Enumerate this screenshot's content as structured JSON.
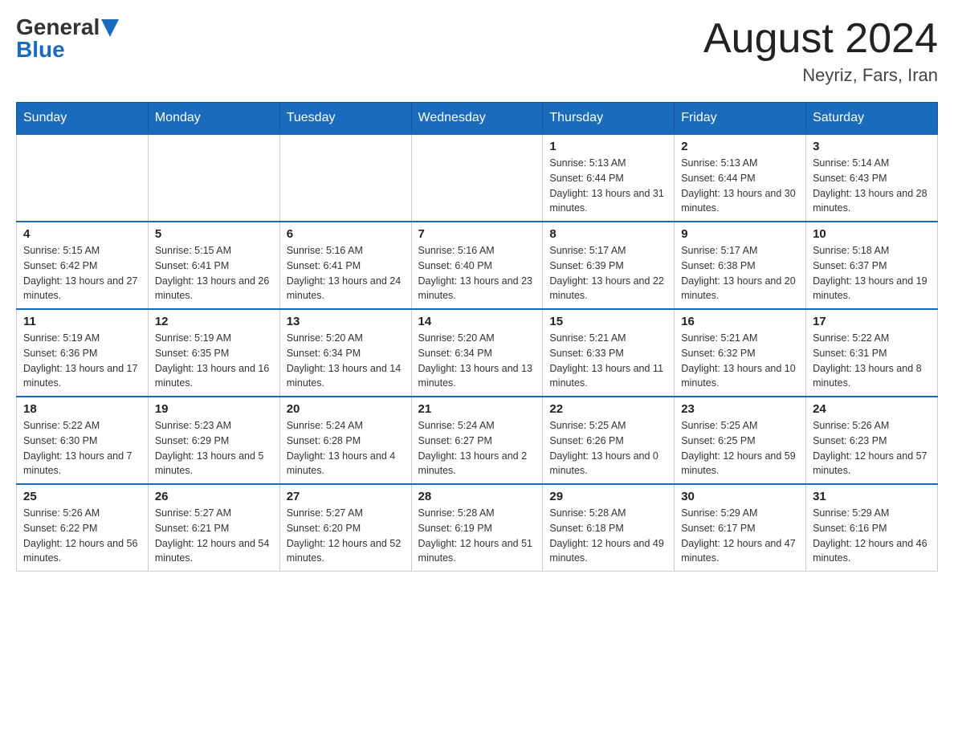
{
  "header": {
    "logo_general": "General",
    "logo_blue": "Blue",
    "month_title": "August 2024",
    "location": "Neyriz, Fars, Iran"
  },
  "days_of_week": [
    "Sunday",
    "Monday",
    "Tuesday",
    "Wednesday",
    "Thursday",
    "Friday",
    "Saturday"
  ],
  "weeks": [
    {
      "days": [
        {
          "number": "",
          "info": ""
        },
        {
          "number": "",
          "info": ""
        },
        {
          "number": "",
          "info": ""
        },
        {
          "number": "",
          "info": ""
        },
        {
          "number": "1",
          "info": "Sunrise: 5:13 AM\nSunset: 6:44 PM\nDaylight: 13 hours and 31 minutes."
        },
        {
          "number": "2",
          "info": "Sunrise: 5:13 AM\nSunset: 6:44 PM\nDaylight: 13 hours and 30 minutes."
        },
        {
          "number": "3",
          "info": "Sunrise: 5:14 AM\nSunset: 6:43 PM\nDaylight: 13 hours and 28 minutes."
        }
      ]
    },
    {
      "days": [
        {
          "number": "4",
          "info": "Sunrise: 5:15 AM\nSunset: 6:42 PM\nDaylight: 13 hours and 27 minutes."
        },
        {
          "number": "5",
          "info": "Sunrise: 5:15 AM\nSunset: 6:41 PM\nDaylight: 13 hours and 26 minutes."
        },
        {
          "number": "6",
          "info": "Sunrise: 5:16 AM\nSunset: 6:41 PM\nDaylight: 13 hours and 24 minutes."
        },
        {
          "number": "7",
          "info": "Sunrise: 5:16 AM\nSunset: 6:40 PM\nDaylight: 13 hours and 23 minutes."
        },
        {
          "number": "8",
          "info": "Sunrise: 5:17 AM\nSunset: 6:39 PM\nDaylight: 13 hours and 22 minutes."
        },
        {
          "number": "9",
          "info": "Sunrise: 5:17 AM\nSunset: 6:38 PM\nDaylight: 13 hours and 20 minutes."
        },
        {
          "number": "10",
          "info": "Sunrise: 5:18 AM\nSunset: 6:37 PM\nDaylight: 13 hours and 19 minutes."
        }
      ]
    },
    {
      "days": [
        {
          "number": "11",
          "info": "Sunrise: 5:19 AM\nSunset: 6:36 PM\nDaylight: 13 hours and 17 minutes."
        },
        {
          "number": "12",
          "info": "Sunrise: 5:19 AM\nSunset: 6:35 PM\nDaylight: 13 hours and 16 minutes."
        },
        {
          "number": "13",
          "info": "Sunrise: 5:20 AM\nSunset: 6:34 PM\nDaylight: 13 hours and 14 minutes."
        },
        {
          "number": "14",
          "info": "Sunrise: 5:20 AM\nSunset: 6:34 PM\nDaylight: 13 hours and 13 minutes."
        },
        {
          "number": "15",
          "info": "Sunrise: 5:21 AM\nSunset: 6:33 PM\nDaylight: 13 hours and 11 minutes."
        },
        {
          "number": "16",
          "info": "Sunrise: 5:21 AM\nSunset: 6:32 PM\nDaylight: 13 hours and 10 minutes."
        },
        {
          "number": "17",
          "info": "Sunrise: 5:22 AM\nSunset: 6:31 PM\nDaylight: 13 hours and 8 minutes."
        }
      ]
    },
    {
      "days": [
        {
          "number": "18",
          "info": "Sunrise: 5:22 AM\nSunset: 6:30 PM\nDaylight: 13 hours and 7 minutes."
        },
        {
          "number": "19",
          "info": "Sunrise: 5:23 AM\nSunset: 6:29 PM\nDaylight: 13 hours and 5 minutes."
        },
        {
          "number": "20",
          "info": "Sunrise: 5:24 AM\nSunset: 6:28 PM\nDaylight: 13 hours and 4 minutes."
        },
        {
          "number": "21",
          "info": "Sunrise: 5:24 AM\nSunset: 6:27 PM\nDaylight: 13 hours and 2 minutes."
        },
        {
          "number": "22",
          "info": "Sunrise: 5:25 AM\nSunset: 6:26 PM\nDaylight: 13 hours and 0 minutes."
        },
        {
          "number": "23",
          "info": "Sunrise: 5:25 AM\nSunset: 6:25 PM\nDaylight: 12 hours and 59 minutes."
        },
        {
          "number": "24",
          "info": "Sunrise: 5:26 AM\nSunset: 6:23 PM\nDaylight: 12 hours and 57 minutes."
        }
      ]
    },
    {
      "days": [
        {
          "number": "25",
          "info": "Sunrise: 5:26 AM\nSunset: 6:22 PM\nDaylight: 12 hours and 56 minutes."
        },
        {
          "number": "26",
          "info": "Sunrise: 5:27 AM\nSunset: 6:21 PM\nDaylight: 12 hours and 54 minutes."
        },
        {
          "number": "27",
          "info": "Sunrise: 5:27 AM\nSunset: 6:20 PM\nDaylight: 12 hours and 52 minutes."
        },
        {
          "number": "28",
          "info": "Sunrise: 5:28 AM\nSunset: 6:19 PM\nDaylight: 12 hours and 51 minutes."
        },
        {
          "number": "29",
          "info": "Sunrise: 5:28 AM\nSunset: 6:18 PM\nDaylight: 12 hours and 49 minutes."
        },
        {
          "number": "30",
          "info": "Sunrise: 5:29 AM\nSunset: 6:17 PM\nDaylight: 12 hours and 47 minutes."
        },
        {
          "number": "31",
          "info": "Sunrise: 5:29 AM\nSunset: 6:16 PM\nDaylight: 12 hours and 46 minutes."
        }
      ]
    }
  ]
}
